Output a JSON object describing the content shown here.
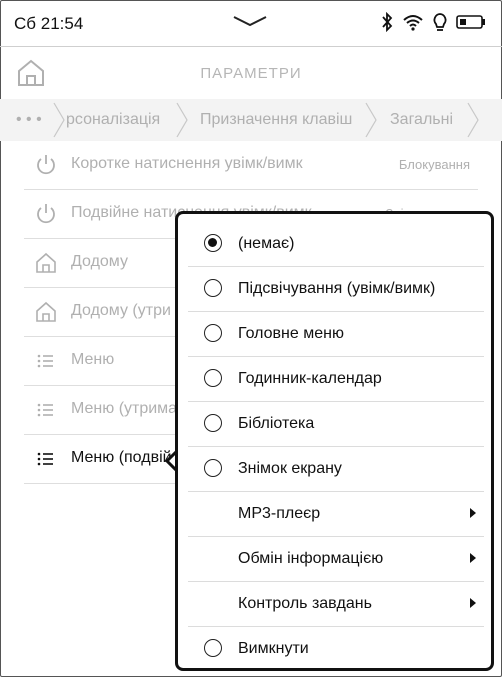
{
  "status_bar": {
    "time": "Сб 21:54",
    "icons": [
      "bluetooth-icon",
      "wifi-icon",
      "bulb-icon",
      "battery-icon"
    ]
  },
  "header": {
    "title": "ПАРАМЕТРИ"
  },
  "breadcrumb": {
    "more": "• • •",
    "items": [
      "рсоналізація",
      "Призначення клавіш",
      "Загальні"
    ]
  },
  "list": {
    "items": [
      {
        "icon": "power-icon",
        "label": "Коротке натиснення увімк/вимк",
        "value": "Блокування"
      },
      {
        "icon": "power-icon",
        "label": "Подвійне натиснення увімк/вимк",
        "value": "Знімок екрану"
      },
      {
        "icon": "home-icon",
        "label": "Додому",
        "value": ""
      },
      {
        "icon": "home-icon",
        "label": "Додому (утри",
        "value": ""
      },
      {
        "icon": "menu-list-icon",
        "label": "Меню",
        "value": ""
      },
      {
        "icon": "menu-list-icon",
        "label": "Меню (утрима",
        "value": ""
      },
      {
        "icon": "menu-list-icon",
        "label": "Меню (подвій",
        "value": ""
      }
    ]
  },
  "popup": {
    "options": [
      {
        "label": "(немає)",
        "type": "radio",
        "selected": true
      },
      {
        "label": "Підсвічування (увімк/вимк)",
        "type": "radio",
        "selected": false
      },
      {
        "label": "Головне меню",
        "type": "radio",
        "selected": false
      },
      {
        "label": "Годинник-календар",
        "type": "radio",
        "selected": false
      },
      {
        "label": "Бібліотека",
        "type": "radio",
        "selected": false
      },
      {
        "label": "Знімок екрану",
        "type": "radio",
        "selected": false
      },
      {
        "label": "MP3-плеєр",
        "type": "submenu"
      },
      {
        "label": "Обмін інформацією",
        "type": "submenu"
      },
      {
        "label": "Контроль завдань",
        "type": "submenu"
      },
      {
        "label": "Вимкнути",
        "type": "radio",
        "selected": false
      }
    ]
  }
}
